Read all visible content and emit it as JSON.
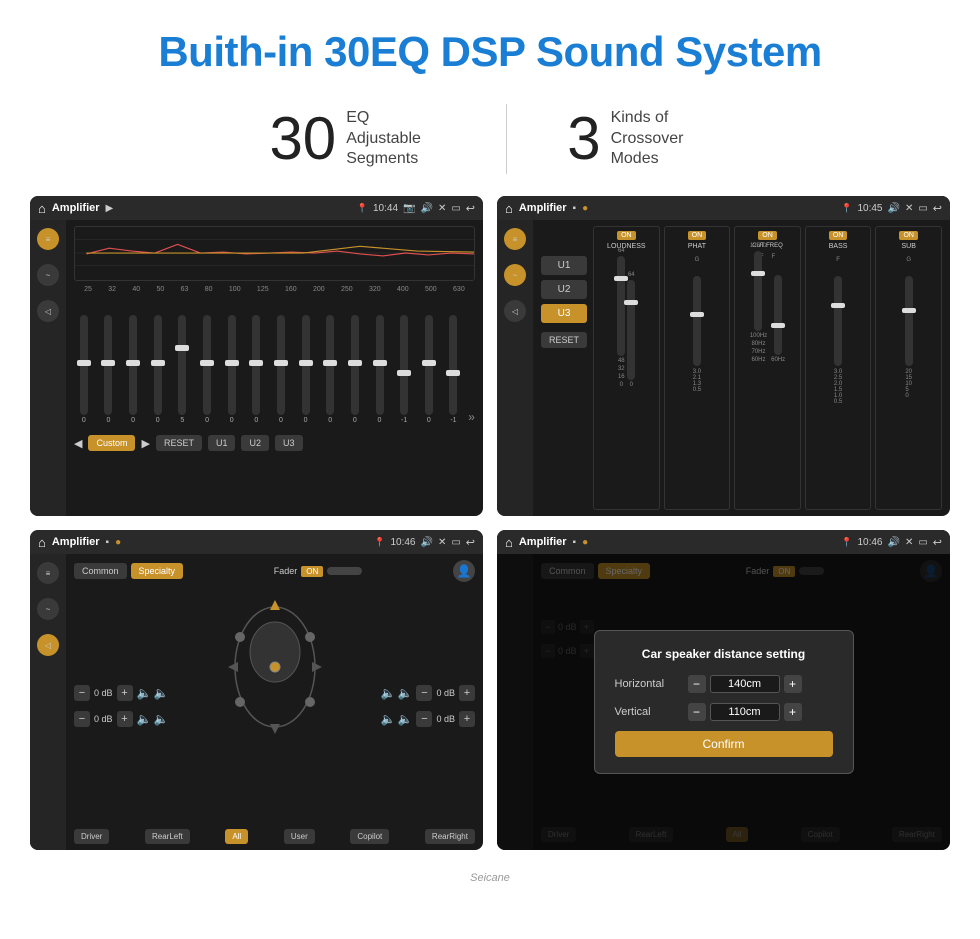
{
  "page": {
    "title": "Buith-in 30EQ DSP Sound System",
    "stats": [
      {
        "number": "30",
        "desc_line1": "EQ Adjustable",
        "desc_line2": "Segments"
      },
      {
        "number": "3",
        "desc_line1": "Kinds of",
        "desc_line2": "Crossover Modes"
      }
    ]
  },
  "screens": {
    "eq_screen": {
      "title": "Amplifier",
      "time": "10:44",
      "freq_labels": [
        "25",
        "32",
        "40",
        "50",
        "63",
        "80",
        "100",
        "125",
        "160",
        "200",
        "250",
        "320",
        "400",
        "500",
        "630"
      ],
      "values": [
        "0",
        "0",
        "0",
        "0",
        "5",
        "0",
        "0",
        "0",
        "0",
        "0",
        "0",
        "0",
        "0",
        "-1",
        "0",
        "-1"
      ],
      "preset": "Custom",
      "buttons": [
        "RESET",
        "U1",
        "U2",
        "U3"
      ],
      "sliders": [
        45,
        50,
        55,
        50,
        70,
        50,
        48,
        50,
        52,
        50,
        50,
        50,
        50,
        40,
        50,
        42
      ]
    },
    "crossover_screen": {
      "title": "Amplifier",
      "time": "10:45",
      "channels": [
        {
          "name": "LOUDNESS",
          "on": true
        },
        {
          "name": "PHAT",
          "on": true
        },
        {
          "name": "CUT FREQ",
          "on": true
        },
        {
          "name": "BASS",
          "on": true
        },
        {
          "name": "SUB",
          "on": true
        }
      ],
      "presets": [
        "U1",
        "U2",
        "U3"
      ],
      "active_preset": "U3",
      "reset_label": "RESET"
    },
    "speaker_screen": {
      "title": "Amplifier",
      "time": "10:46",
      "presets": [
        "Common",
        "Specialty"
      ],
      "active_preset": "Specialty",
      "fader_label": "Fader",
      "fader_on": "ON",
      "volumes": [
        "0 dB",
        "0 dB",
        "0 dB",
        "0 dB"
      ],
      "location_buttons": [
        "Driver",
        "RearLeft",
        "All",
        "User",
        "Copilot",
        "RearRight"
      ],
      "active_location": "All"
    },
    "dialog_screen": {
      "title": "Amplifier",
      "time": "10:46",
      "dialog_title": "Car speaker distance setting",
      "horizontal_label": "Horizontal",
      "horizontal_value": "140cm",
      "vertical_label": "Vertical",
      "vertical_value": "110cm",
      "confirm_label": "Confirm",
      "presets": [
        "Common",
        "Specialty"
      ],
      "active_preset": "Specialty",
      "fader_on": "ON",
      "volumes": [
        "0 dB",
        "0 dB"
      ],
      "location_buttons_visible": [
        "Driver",
        "RearLeft",
        "All",
        "Copilot",
        "RearRight"
      ]
    }
  },
  "watermark": "Seicane"
}
